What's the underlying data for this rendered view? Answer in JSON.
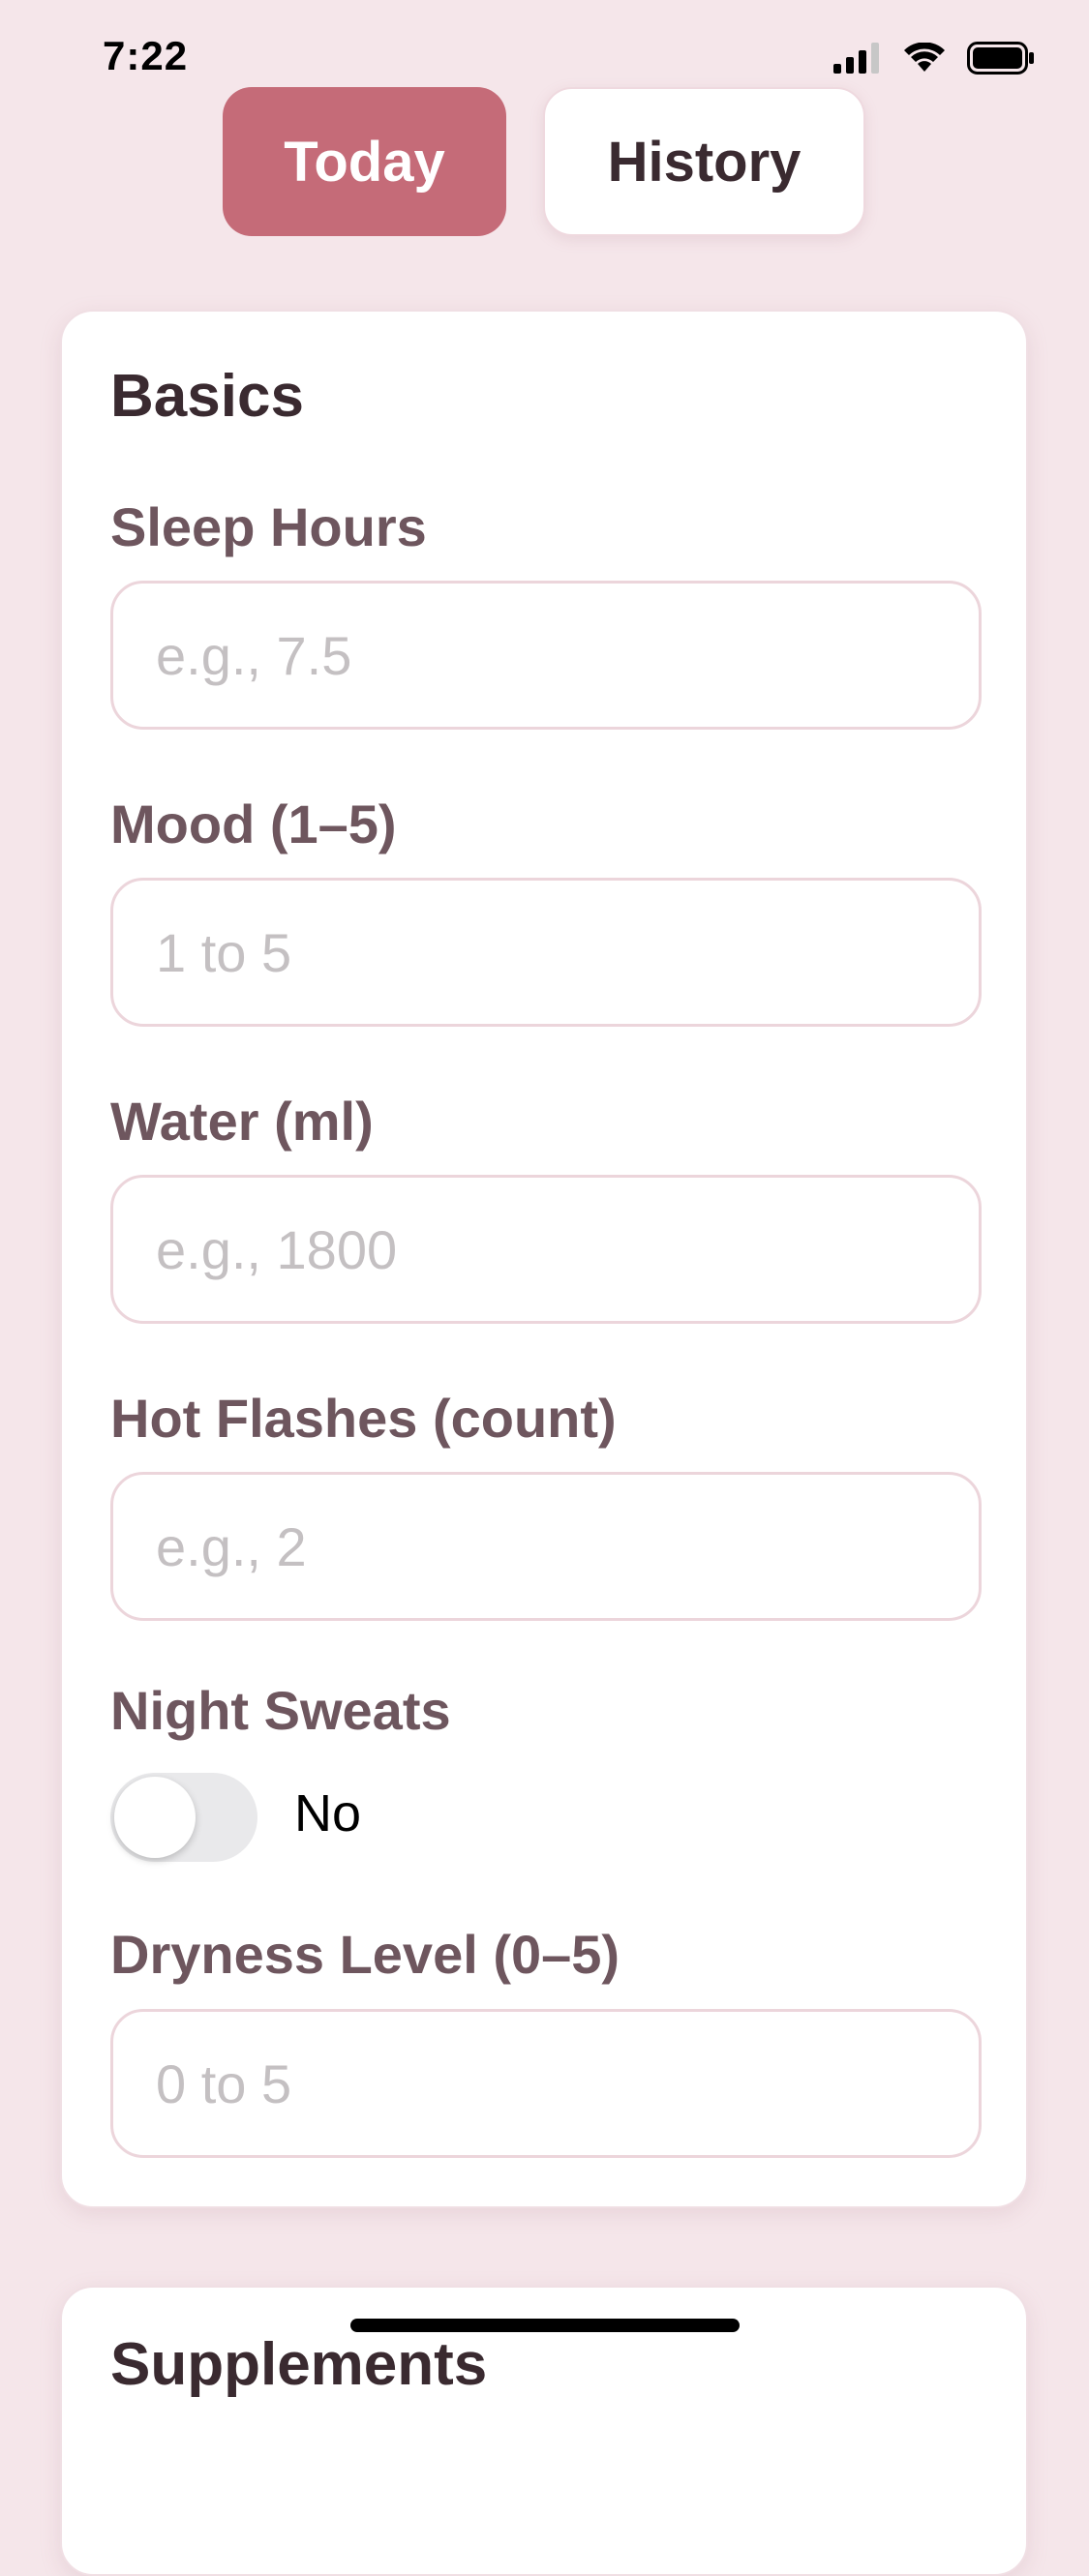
{
  "status_bar": {
    "time": "7:22",
    "icons": [
      "cellular-signal-icon",
      "wifi-icon",
      "battery-icon"
    ]
  },
  "tabs": {
    "today": "Today",
    "history": "History",
    "selected": "Today"
  },
  "colors": {
    "accent": "#c56b78",
    "background": "#f5e6ea",
    "label": "#6e565e",
    "title": "#3a2a30"
  },
  "basics": {
    "title": "Basics",
    "sleep": {
      "label": "Sleep Hours",
      "placeholder": "e.g., 7.5"
    },
    "mood": {
      "label": "Mood (1–5)",
      "placeholder": "1 to 5"
    },
    "water": {
      "label": "Water (ml)",
      "placeholder": "e.g., 1800"
    },
    "hot_flashes": {
      "label": "Hot Flashes (count)",
      "placeholder": "e.g., 2"
    },
    "night_sweats": {
      "label": "Night Sweats",
      "value": "No",
      "on": false
    },
    "dryness": {
      "label": "Dryness Level (0–5)",
      "placeholder": "0 to 5"
    }
  },
  "supplements": {
    "title": "Supplements"
  }
}
